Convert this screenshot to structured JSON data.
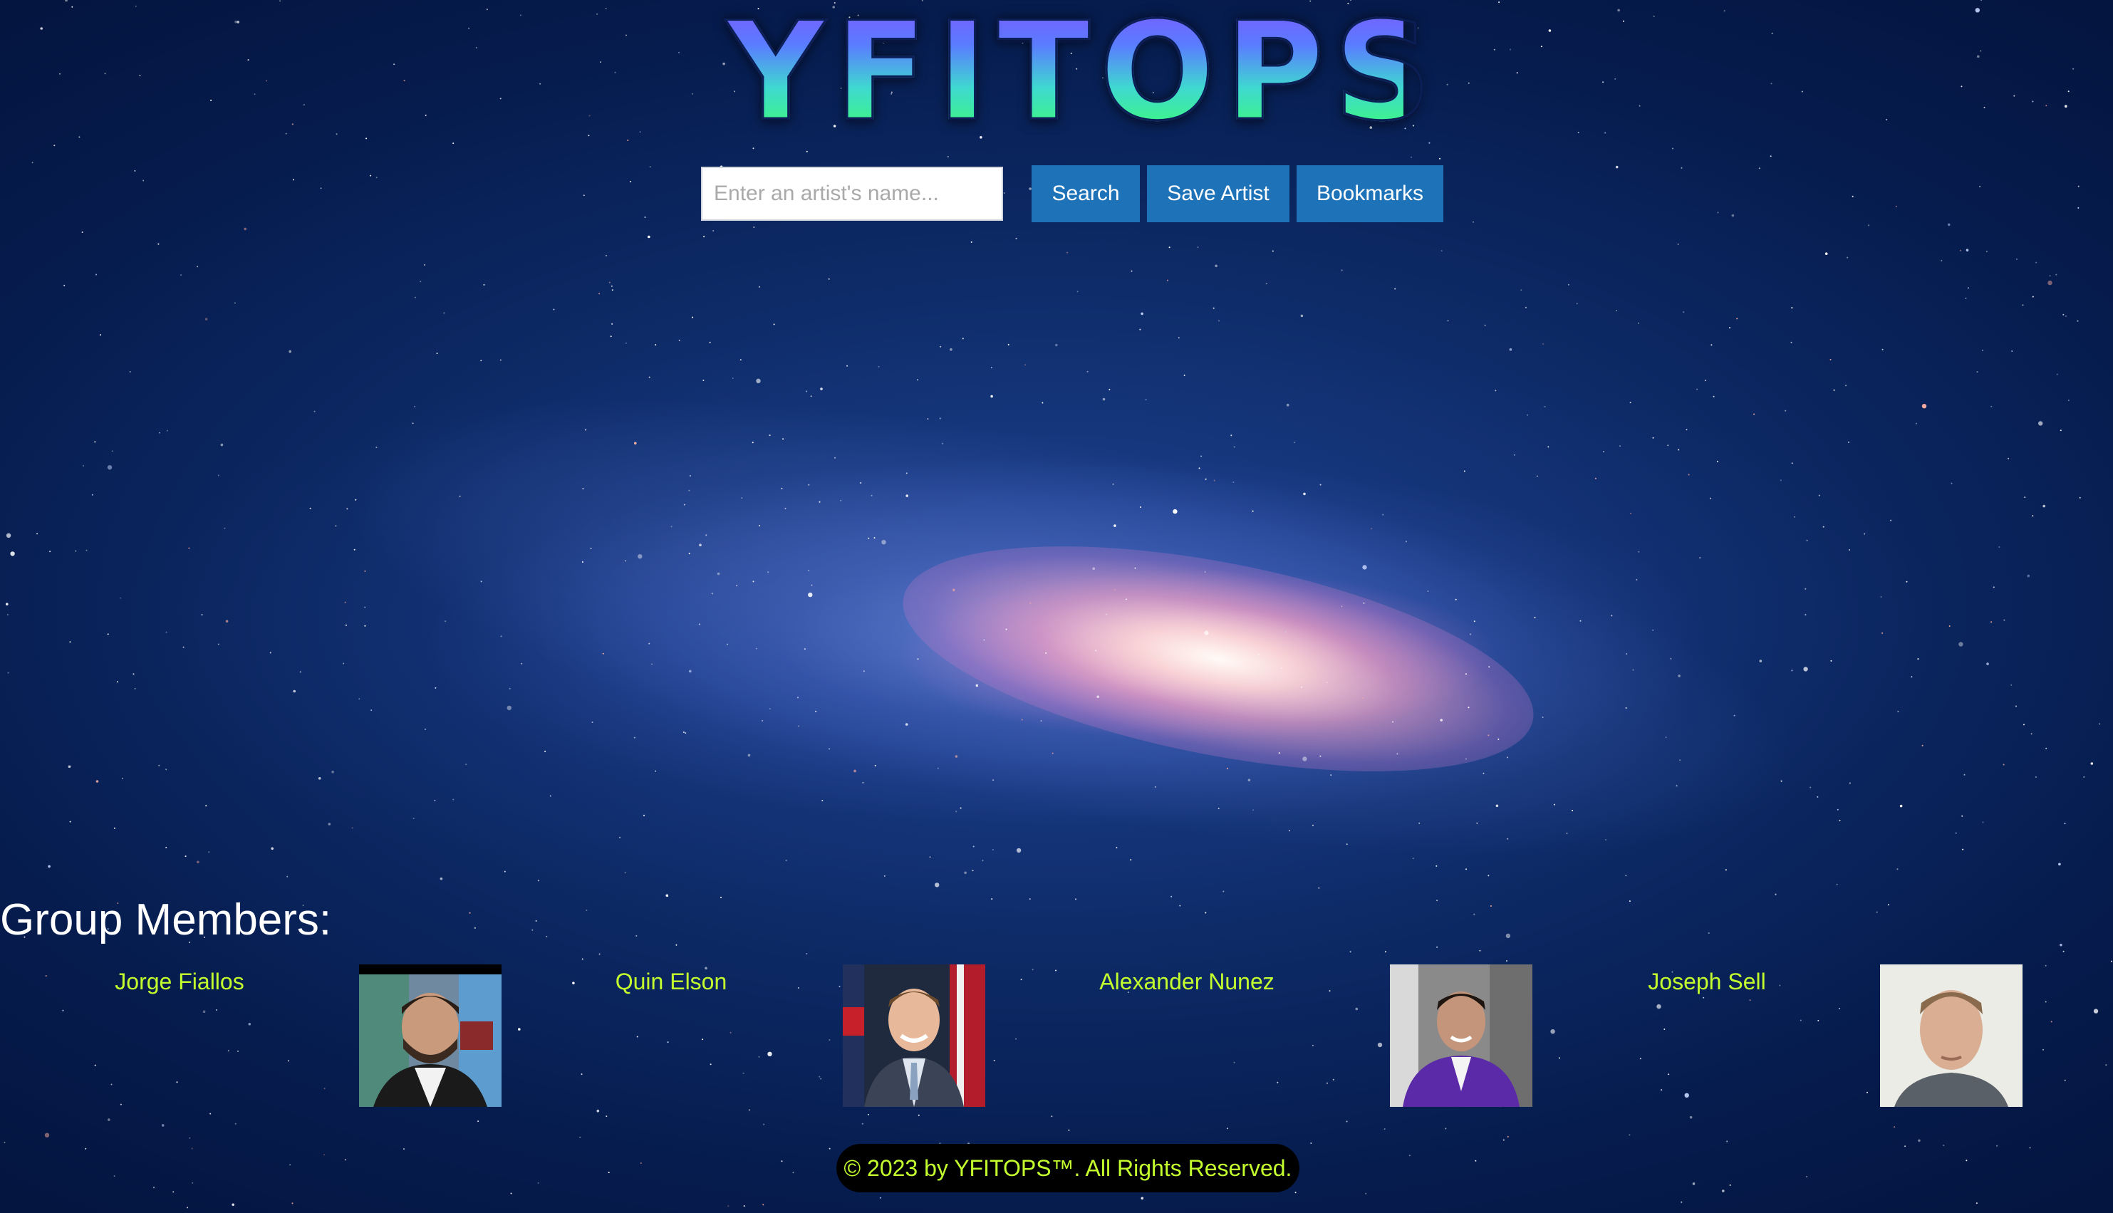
{
  "header": {
    "logo_text": "YFITOPS"
  },
  "search": {
    "placeholder": "Enter an artist's name...",
    "value": "",
    "search_label": "Search",
    "save_label": "Save Artist",
    "bookmarks_label": "Bookmarks"
  },
  "members": {
    "heading": "Group Members:",
    "list": [
      {
        "name": "Jorge Fiallos",
        "photo": "headshot-photo"
      },
      {
        "name": "Quin Elson",
        "photo": "headshot-photo"
      },
      {
        "name": "Alexander Nunez",
        "photo": "headshot-photo"
      },
      {
        "name": "Joseph Sell",
        "photo": "headshot-photo"
      }
    ]
  },
  "footer": {
    "copyright": "© 2023 by YFITOPS™. All Rights Reserved."
  },
  "colors": {
    "button": "#1d72b8",
    "member_name": "#c4ff2e",
    "background": "#061c4e"
  }
}
